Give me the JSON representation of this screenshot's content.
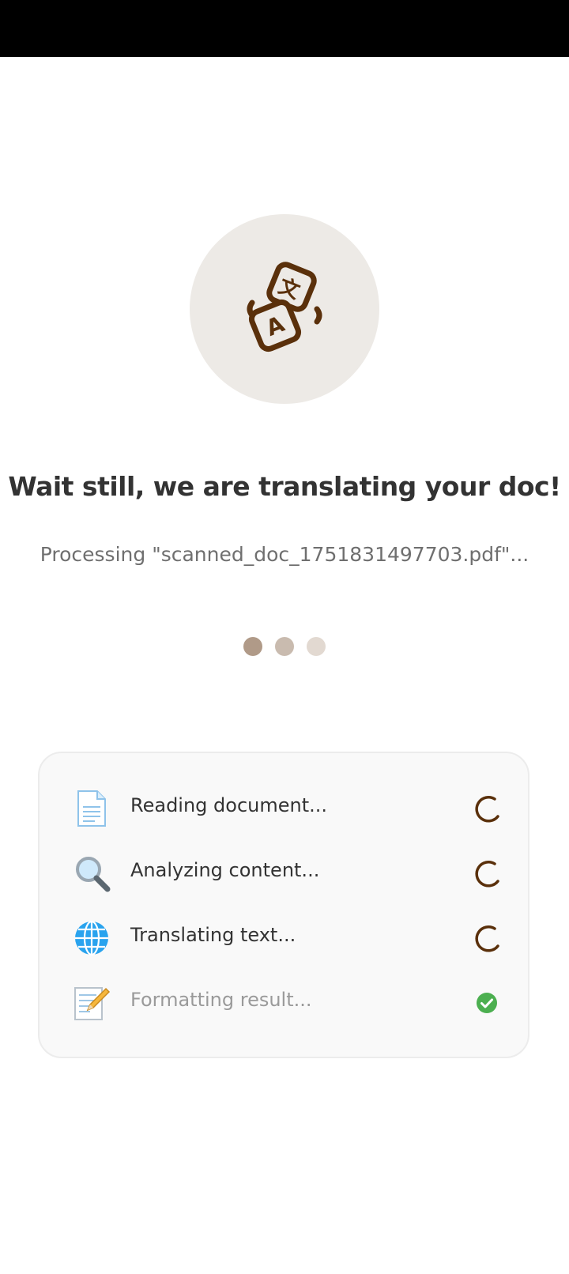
{
  "header": {
    "title": "Wait still, we are translating your doc!"
  },
  "processing": {
    "text": "Processing \"scanned_doc_1751831497703.pdf\"..."
  },
  "progress_dots": [
    {
      "color": "#b09a88"
    },
    {
      "color": "#c9bbaf"
    },
    {
      "color": "#e2d9d1"
    }
  ],
  "steps": [
    {
      "label": "Reading document...",
      "icon": "page-icon",
      "status": "in-progress"
    },
    {
      "label": "Analyzing content...",
      "icon": "magnifier-icon",
      "status": "in-progress"
    },
    {
      "label": "Translating text...",
      "icon": "globe-icon",
      "status": "in-progress"
    },
    {
      "label": "Formatting result...",
      "icon": "memo-icon",
      "status": "done"
    }
  ],
  "colors": {
    "accent": "#5a300b",
    "done": "#4caf50",
    "hero_bg": "#edeae6"
  }
}
